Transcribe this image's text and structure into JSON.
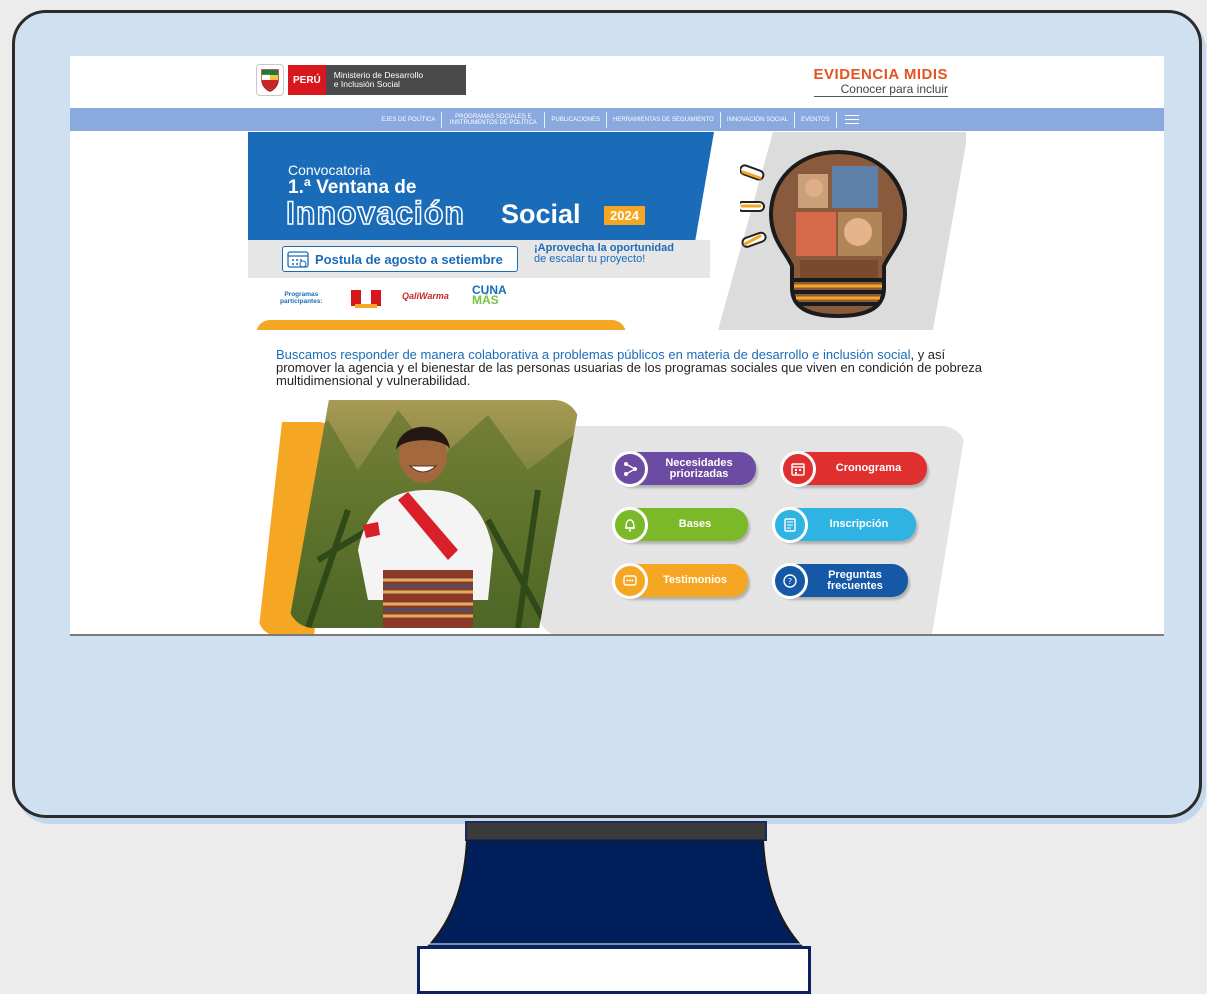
{
  "header": {
    "country": "PERÚ",
    "ministry_line1": "Ministerio de Desarrollo",
    "ministry_line2": "e Inclusión Social",
    "brand_title": "EVIDENCIA MIDIS",
    "brand_subtitle": "Conocer para incluir"
  },
  "nav": {
    "items": [
      "EJES DE POLÍTICA",
      "PROGRAMAS SOCIALES E INSTRUMENTOS DE POLÍTICA",
      "PUBLICACIONES",
      "HERRAMIENTAS DE SEGUIMIENTO",
      "INNOVACIÓN SOCIAL",
      "EVENTOS"
    ],
    "menu_icon": "hamburger-menu-icon"
  },
  "banner": {
    "convocatoria": "Convocatoria",
    "ventana": "1.ª Ventana de",
    "innovacion": "Innovación",
    "social": "Social",
    "year": "2024",
    "postula": "Postula de agosto a setiembre",
    "aprovecha_bold": "¡Aprovecha la oportunidad",
    "aprovecha_rest": "de escalar tu proyecto!",
    "programs_label_1": "Programas",
    "programs_label_2": "participantes:",
    "qali": "QaliWarma",
    "cuna_1": "CUNA",
    "cuna_2": "MÁS"
  },
  "intro": {
    "highlight": "Buscamos responder de manera colaborativa a problemas públicos en materia de desarrollo e inclusión social",
    "rest": ", y así promover la agencia y el bienestar de las personas usuarias de los programas sociales que viven en condición de pobreza multidimensional y vulnerabilidad."
  },
  "buttons": {
    "necesidades_1": "Necesidades",
    "necesidades_2": "priorizadas",
    "cronograma": "Cronograma",
    "bases": "Bases",
    "inscripcion": "Inscripción",
    "testimonios": "Testimonios",
    "preguntas_1": "Preguntas",
    "preguntas_2": "frecuentes"
  },
  "colors": {
    "nav_bg": "#8aa9df",
    "brand_orange": "#e35420",
    "banner_blue": "#1a6cb8",
    "accent_orange": "#f5a623",
    "monitor_bg": "#cfe0f1"
  }
}
